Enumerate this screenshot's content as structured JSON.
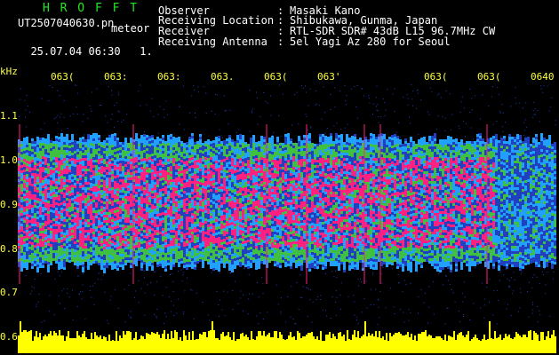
{
  "header": {
    "app_title": "H R O F F T",
    "filename": "UT2507040630.pn",
    "tag": "meteor",
    "datetime": "25.07.04 06:30",
    "page": "1.",
    "info": [
      {
        "label": "Observer",
        "value": "Masaki Kano"
      },
      {
        "label": "Receiving Location",
        "value": "Shibukawa, Gunma, Japan"
      },
      {
        "label": "Receiver",
        "value": "RTL-SDR SDR# 43dB L15 96.7MHz CW"
      },
      {
        "label": "Receiving Antenna",
        "value": "5el Yagi Az 280 for Seoul"
      }
    ]
  },
  "axis": {
    "y_unit": "kHz",
    "y_ticks": [
      "1.1",
      "1.0",
      "0.9",
      "0.8",
      "0.7",
      "0.6"
    ],
    "x_ticks": [
      "063(",
      "063:",
      "063:",
      "063.",
      "063(",
      "063'",
      "063(",
      "063(",
      "0640"
    ]
  },
  "colors": {
    "background": "#000000",
    "title": "#20e820",
    "axis_text": "#ffff40",
    "signal_peak": "#ff2080",
    "signal_high": "#40c040",
    "signal_mid": "#20a0ff",
    "signal_low": "#2040c0",
    "level_trace": "#ffff00"
  }
}
